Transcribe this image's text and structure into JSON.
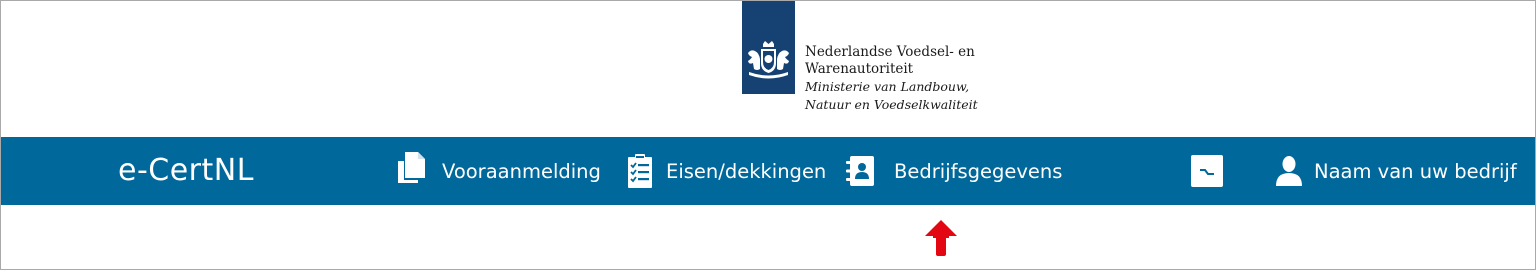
{
  "header": {
    "org_line1": "Nederlandse Voedsel- en",
    "org_line2": "Warenautoriteit",
    "ministry_line1": "Ministerie van Landbouw,",
    "ministry_line2": "Natuur en Voedselkwaliteit",
    "logo_color": "#154273"
  },
  "navbar": {
    "brand": "e-CertNL",
    "background": "#01689b",
    "items": [
      {
        "label": "Vooraanmelding",
        "icon": "documents-icon"
      },
      {
        "label": "Eisen/dekkingen",
        "icon": "clipboard-checklist-icon"
      },
      {
        "label": "Bedrijfsgegevens",
        "icon": "address-book-icon"
      }
    ],
    "logout_icon": "logout-icon",
    "user": {
      "label": "Naam van uw bedrijf",
      "icon": "user-icon"
    }
  },
  "annotation": {
    "icon": "red-up-arrow-icon",
    "color": "#e30613"
  }
}
